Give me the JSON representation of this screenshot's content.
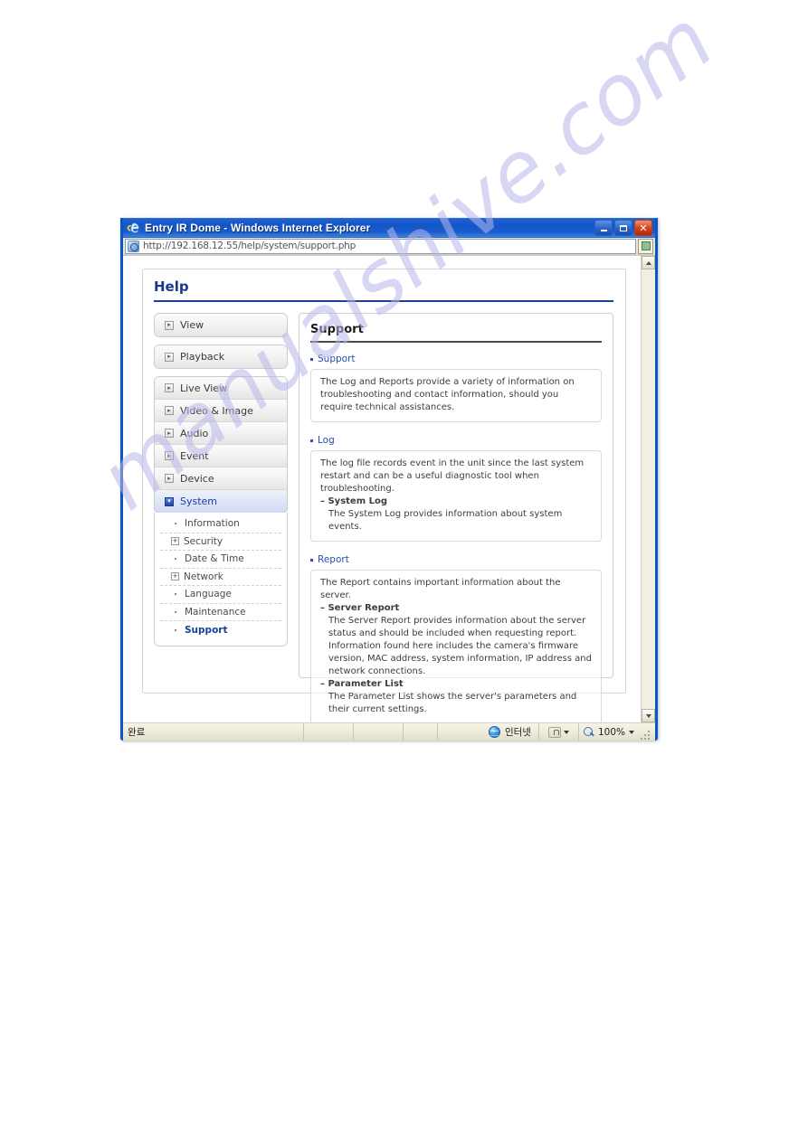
{
  "window": {
    "title": "Entry IR Dome - Windows Internet Explorer",
    "app_icon": "ie-logo-icon",
    "minimize_label": "",
    "maximize_label": "",
    "close_label": "✕",
    "accent_color": "#1356c9"
  },
  "address_bar": {
    "url": "http://192.168.12.55/help/system/support.php",
    "icon": "page-icon",
    "go_icon": "go-icon"
  },
  "page": {
    "title": "Help",
    "accent_color": "#1b3f9b"
  },
  "sidebar": {
    "top_buttons": [
      {
        "label": "View",
        "icon": "expand-box-icon"
      },
      {
        "label": "Playback",
        "icon": "expand-box-icon"
      }
    ],
    "items": [
      {
        "label": "Live View",
        "icon": "expand-box-icon",
        "active": false
      },
      {
        "label": "Video & Image",
        "icon": "expand-box-icon",
        "active": false
      },
      {
        "label": "Audio",
        "icon": "expand-box-icon",
        "active": false
      },
      {
        "label": "Event",
        "icon": "expand-box-icon",
        "active": false
      },
      {
        "label": "Device",
        "icon": "expand-box-icon",
        "active": false
      },
      {
        "label": "System",
        "icon": "collapse-box-icon",
        "active": true
      }
    ],
    "subitems": [
      {
        "label": "Information",
        "marker": "dot",
        "current": false
      },
      {
        "label": "Security",
        "marker": "plus",
        "current": false
      },
      {
        "label": "Date & Time",
        "marker": "dot",
        "current": false
      },
      {
        "label": "Network",
        "marker": "plus",
        "current": false
      },
      {
        "label": "Language",
        "marker": "dot",
        "current": false
      },
      {
        "label": "Maintenance",
        "marker": "dot",
        "current": false
      },
      {
        "label": "Support",
        "marker": "dot",
        "current": true
      }
    ]
  },
  "content": {
    "heading": "Support",
    "sections": [
      {
        "label": "Support",
        "body": "The Log and Reports provide a variety of information on troubleshooting and contact information, should you require technical assistances."
      },
      {
        "label": "Log",
        "body": "The log file records event in the unit since the last system restart and can be a useful diagnostic tool when troubleshooting.",
        "sub_heading_1": "– System Log",
        "sub_body_1": "The System Log provides information about system events."
      },
      {
        "label": "Report",
        "body": "The Report contains important information about the server.",
        "sub_heading_1": "– Server Report",
        "sub_body_1": "The Server Report provides information about the server status and should be included when requesting report. Information found here includes the camera's firmware version, MAC address, system information, IP address and network connections.",
        "sub_heading_2": "– Parameter List",
        "sub_body_2": "The Parameter List shows the server's parameters and their current settings."
      }
    ]
  },
  "status_bar": {
    "status_text": "완료",
    "zone_icon": "globe-icon",
    "zone_label": "인터넷",
    "security_icon": "lock-icon",
    "zoom_icon": "magnifier-icon",
    "zoom_level": "100%"
  },
  "watermark": {
    "text": "manualshive.com",
    "color": "#b9b8ea"
  }
}
